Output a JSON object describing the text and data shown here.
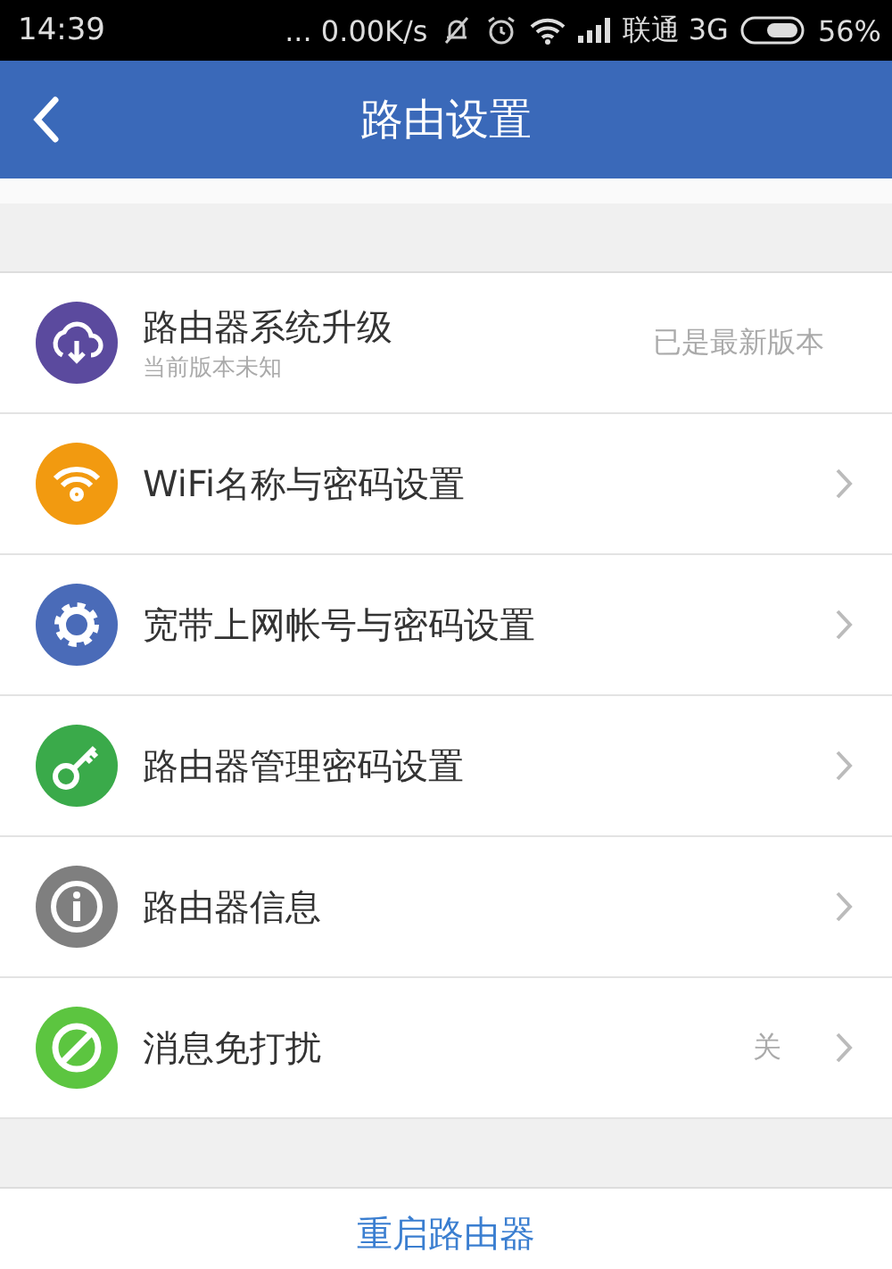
{
  "status_bar": {
    "time": "14:39",
    "net_speed": "... 0.00K/s",
    "carrier": "联通 3G",
    "battery": "56%"
  },
  "header": {
    "title": "路由设置"
  },
  "items": [
    {
      "kind": "cloud",
      "color": "#5b4a9e",
      "title": "路由器系统升级",
      "subtitle": "当前版本未知",
      "value": "已是最新版本",
      "chevron": false
    },
    {
      "kind": "wifi",
      "color": "#f29a10",
      "title": "WiFi名称与密码设置",
      "chevron": true
    },
    {
      "kind": "gear",
      "color": "#4a6bb8",
      "title": "宽带上网帐号与密码设置",
      "chevron": true
    },
    {
      "kind": "key",
      "color": "#3aaa4a",
      "title": "路由器管理密码设置",
      "chevron": true
    },
    {
      "kind": "info",
      "color": "#7f7f7f",
      "title": "路由器信息",
      "chevron": true
    },
    {
      "kind": "block",
      "color": "#5cc540",
      "title": "消息免打扰",
      "value": "关",
      "chevron": true
    }
  ],
  "restart_button": "重启路由器"
}
